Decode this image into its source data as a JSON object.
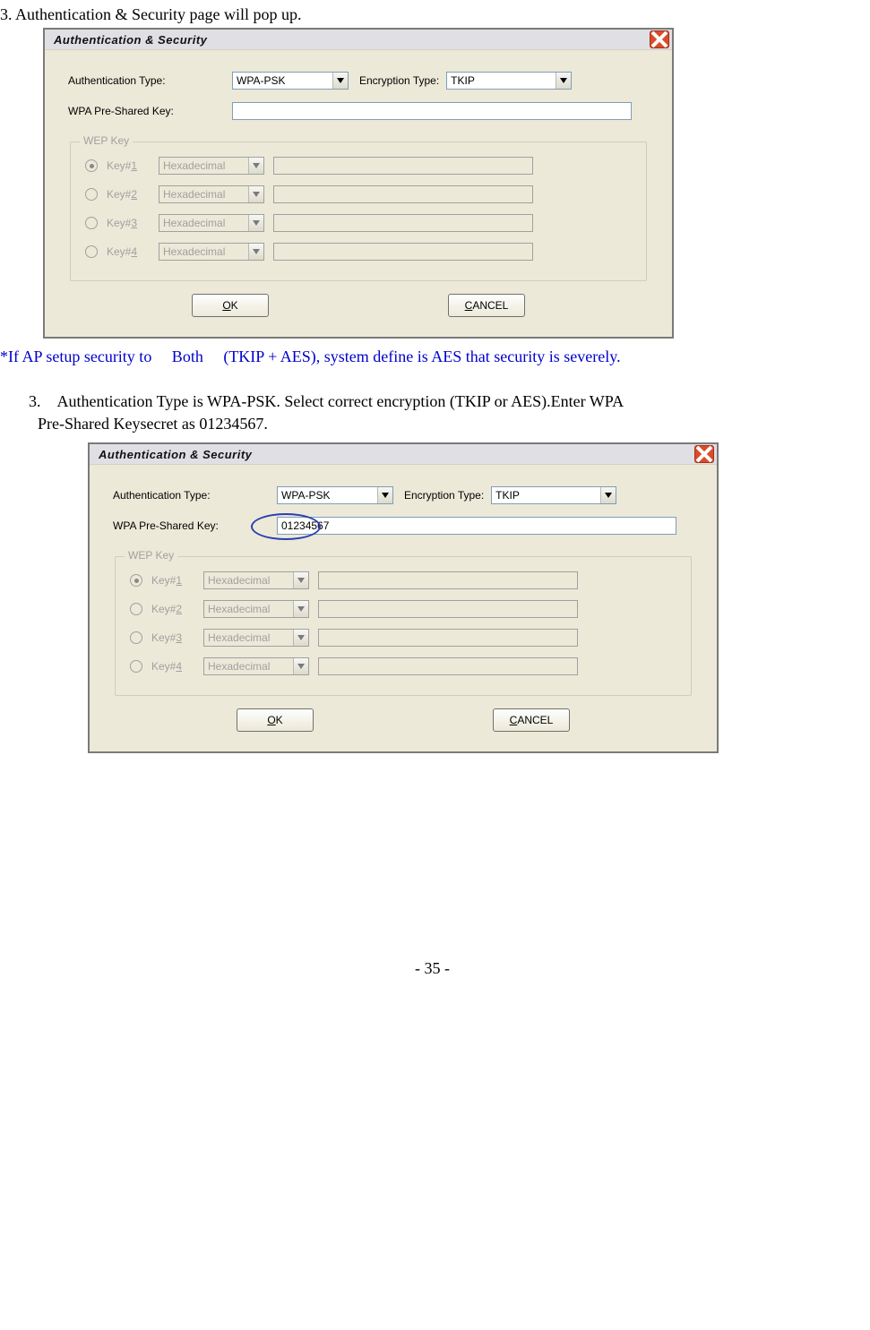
{
  "intro": "3. Authentication & Security page will pop up.",
  "note": "*If AP setup security to 　Both 　(TKIP + AES), system define is AES that security is severely.",
  "step3a": "3. Authentication Type is WPA-PSK. Select correct encryption (TKIP or AES).Enter WPA",
  "step3b": "Pre-Shared Keysecret as 01234567.",
  "pageNumber": "- 35 -",
  "dialog": {
    "title": "Authentication & Security",
    "labels": {
      "authType": "Authentication Type:",
      "encType": "Encryption Type:",
      "psk": "WPA Pre-Shared Key:",
      "wepGroup": "WEP Key"
    },
    "values": {
      "authType": "WPA-PSK",
      "encType": "TKIP"
    },
    "psk1": "",
    "psk2": "01234567",
    "wepKeys": [
      {
        "label": "Key#",
        "num": "1",
        "format": "Hexadecimal",
        "selected": true
      },
      {
        "label": "Key#",
        "num": "2",
        "format": "Hexadecimal",
        "selected": false
      },
      {
        "label": "Key#",
        "num": "3",
        "format": "Hexadecimal",
        "selected": false
      },
      {
        "label": "Key#",
        "num": "4",
        "format": "Hexadecimal",
        "selected": false
      }
    ],
    "buttons": {
      "ok_pre": "O",
      "ok_post": "K",
      "cancel_pre": "C",
      "cancel_post": "ANCEL"
    }
  }
}
